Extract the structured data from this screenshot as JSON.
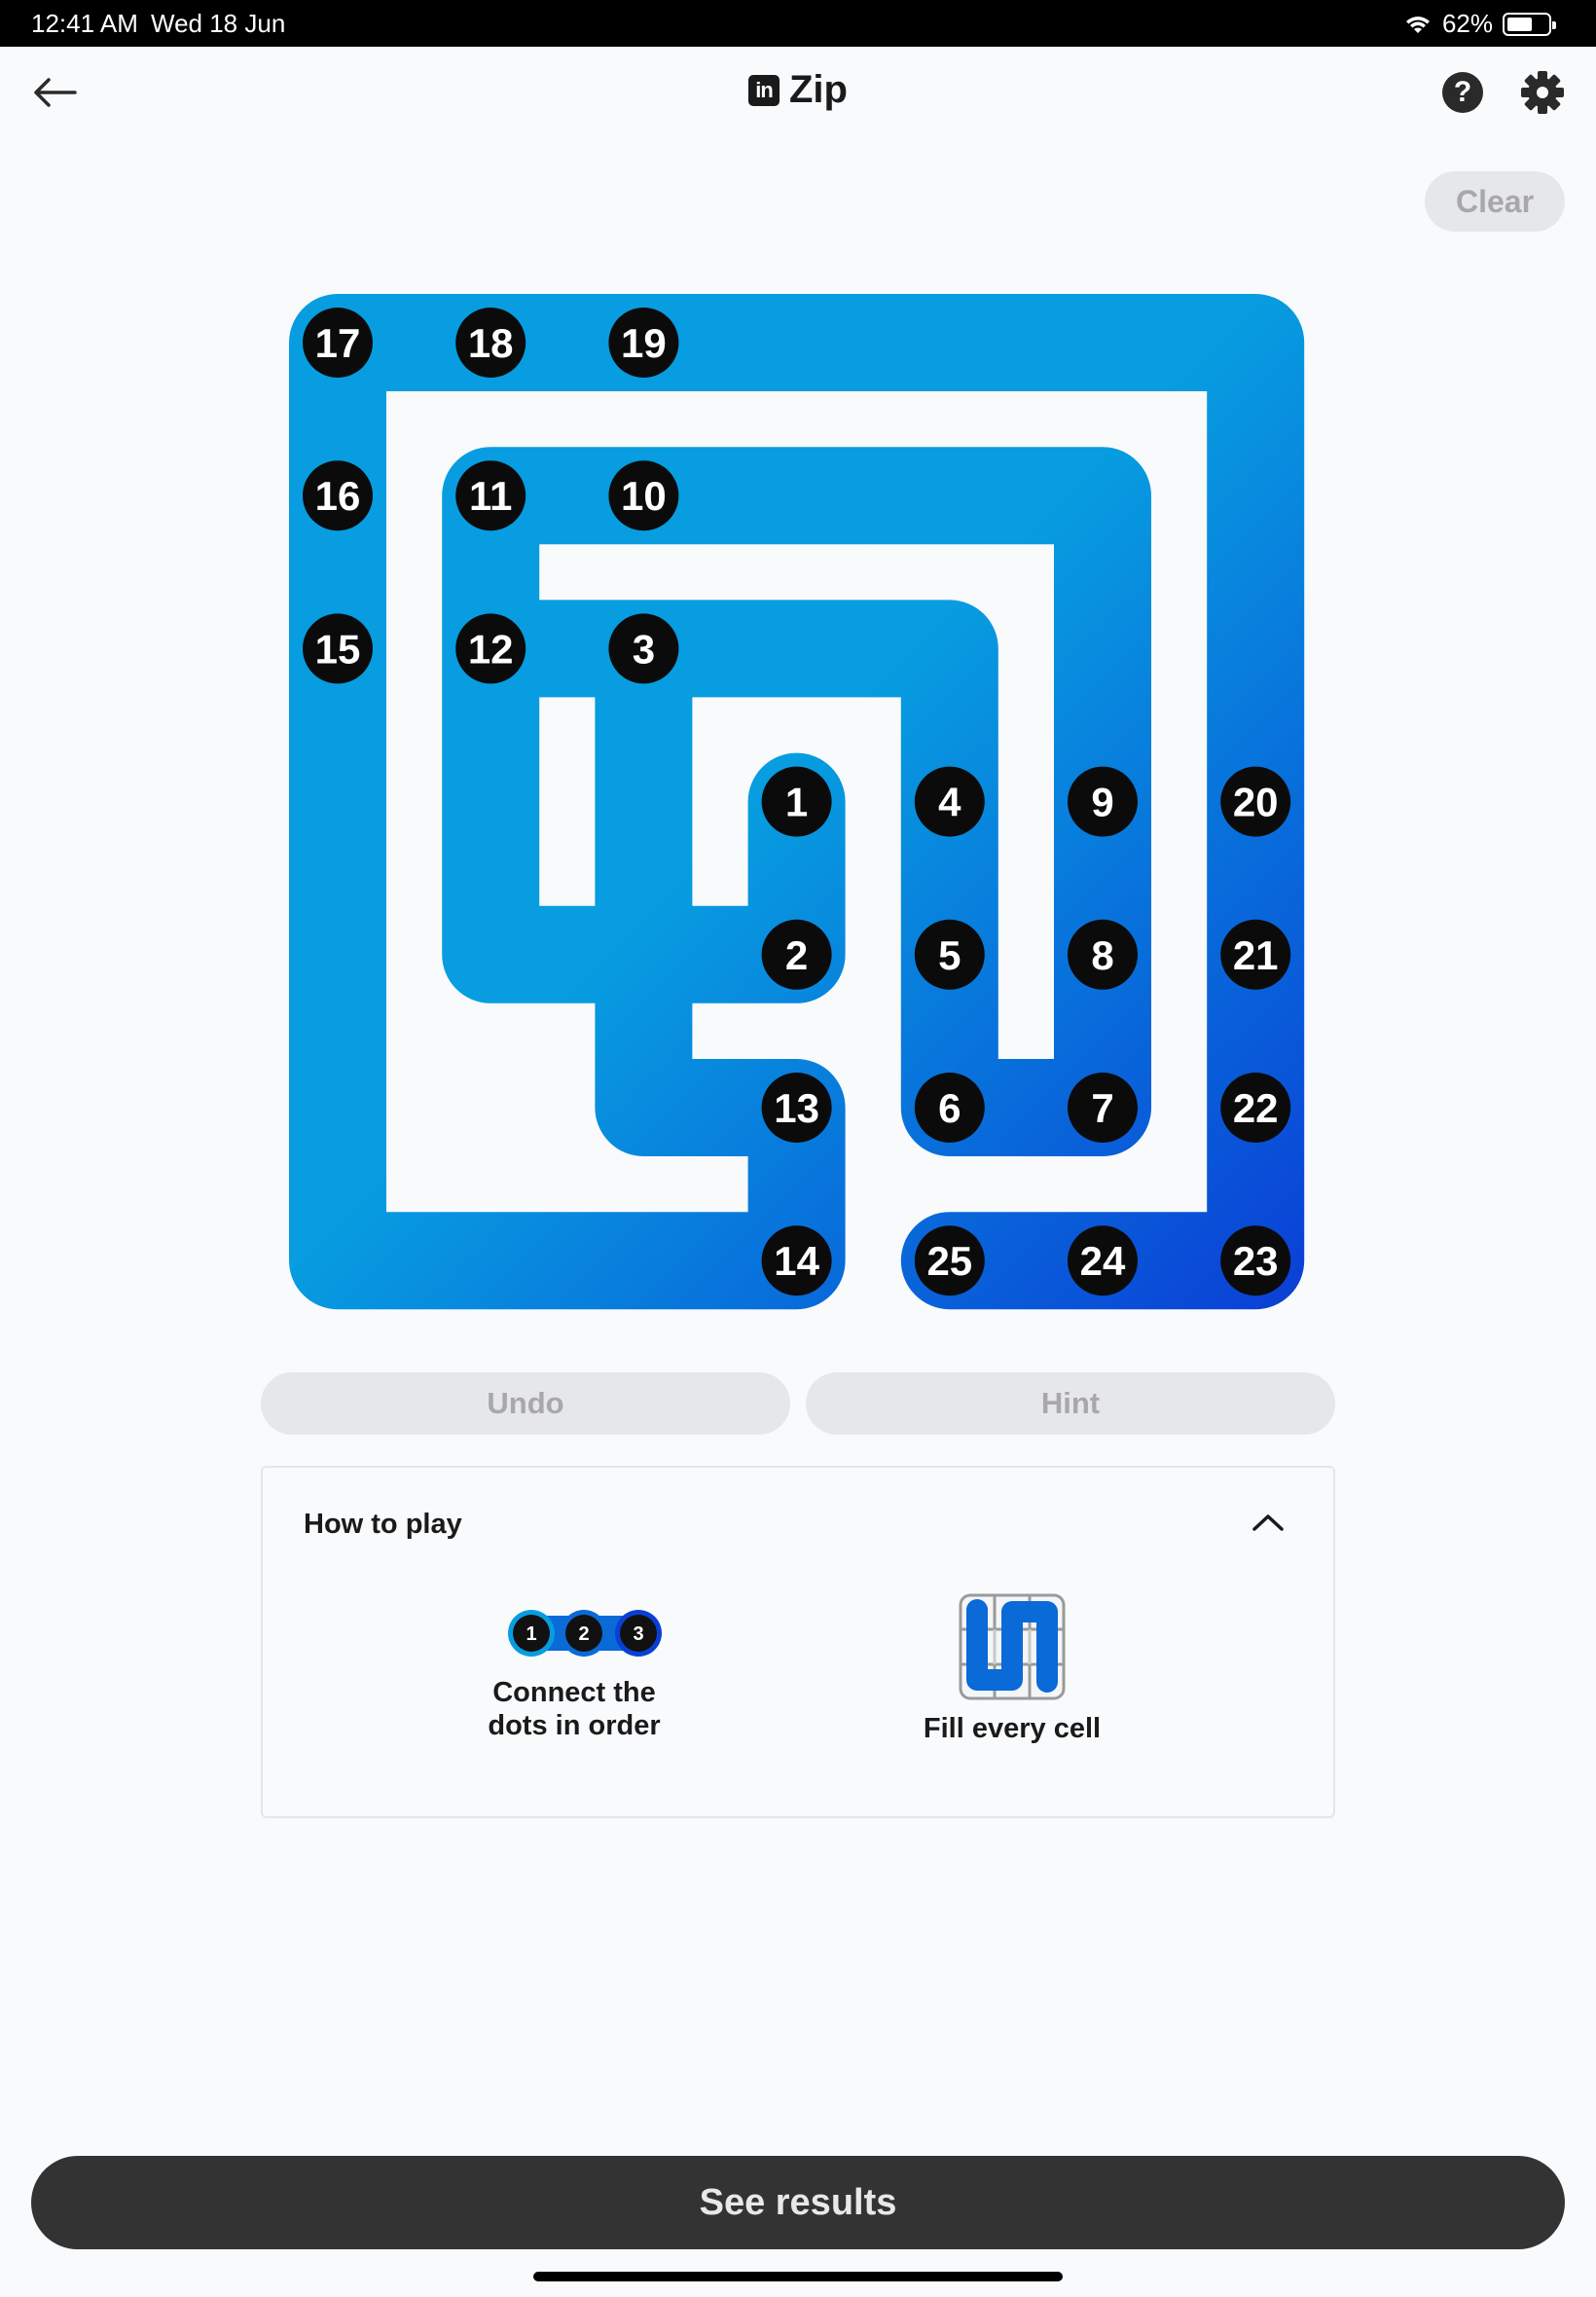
{
  "status_bar": {
    "time": "12:41 AM",
    "date": "Wed 18 Jun",
    "battery": "62%",
    "battery_level": 0.62
  },
  "header": {
    "title": "Zip",
    "logo_text": "in"
  },
  "toolbar": {
    "clear_label": "Clear"
  },
  "puzzle": {
    "grid_size": 6,
    "numbers": [
      {
        "n": 17,
        "row": 0,
        "col": 0
      },
      {
        "n": 18,
        "row": 0,
        "col": 1
      },
      {
        "n": 19,
        "row": 0,
        "col": 2
      },
      {
        "n": 16,
        "row": 1,
        "col": 0
      },
      {
        "n": 11,
        "row": 1,
        "col": 1
      },
      {
        "n": 10,
        "row": 1,
        "col": 2
      },
      {
        "n": 15,
        "row": 2,
        "col": 0
      },
      {
        "n": 12,
        "row": 2,
        "col": 1
      },
      {
        "n": 3,
        "row": 2,
        "col": 2
      },
      {
        "n": 1,
        "row": 3,
        "col": 3
      },
      {
        "n": 4,
        "row": 3,
        "col": 4
      },
      {
        "n": 9,
        "row": 3,
        "col": 5
      },
      {
        "n": 20,
        "row": 3,
        "col": 6
      },
      {
        "n": 2,
        "row": 4,
        "col": 3
      },
      {
        "n": 5,
        "row": 4,
        "col": 4
      },
      {
        "n": 8,
        "row": 4,
        "col": 5
      },
      {
        "n": 21,
        "row": 4,
        "col": 6
      },
      {
        "n": 13,
        "row": 5,
        "col": 3
      },
      {
        "n": 6,
        "row": 5,
        "col": 4
      },
      {
        "n": 7,
        "row": 5,
        "col": 5
      },
      {
        "n": 22,
        "row": 5,
        "col": 6
      },
      {
        "n": 14,
        "row": 6,
        "col": 3
      },
      {
        "n": 25,
        "row": 6,
        "col": 4
      },
      {
        "n": 24,
        "row": 6,
        "col": 5
      },
      {
        "n": 23,
        "row": 6,
        "col": 6
      }
    ],
    "path": [
      [
        3,
        3
      ],
      [
        4,
        3
      ],
      [
        4,
        2
      ],
      [
        4,
        1
      ],
      [
        3,
        1
      ],
      [
        2,
        1
      ],
      [
        2,
        2
      ],
      [
        2,
        3
      ],
      [
        2,
        4
      ],
      [
        3,
        4
      ],
      [
        4,
        4
      ],
      [
        5,
        4
      ],
      [
        5,
        5
      ],
      [
        4,
        5
      ],
      [
        3,
        5
      ],
      [
        2,
        5
      ],
      [
        1,
        5
      ],
      [
        1,
        4
      ],
      [
        1,
        3
      ],
      [
        1,
        2
      ],
      [
        1,
        1
      ],
      [
        2,
        1
      ],
      [
        2,
        2
      ],
      [
        3,
        2
      ],
      [
        4,
        2
      ],
      [
        5,
        2
      ],
      [
        5,
        3
      ],
      [
        6,
        3
      ],
      [
        6,
        2
      ],
      [
        6,
        1
      ],
      [
        6,
        0
      ],
      [
        5,
        0
      ],
      [
        4,
        0
      ],
      [
        3,
        0
      ],
      [
        2,
        0
      ],
      [
        1,
        0
      ],
      [
        0,
        0
      ],
      [
        0,
        1
      ],
      [
        0,
        2
      ],
      [
        0,
        3
      ],
      [
        0,
        4
      ],
      [
        0,
        5
      ],
      [
        0,
        6
      ],
      [
        1,
        6
      ],
      [
        2,
        6
      ],
      [
        3,
        6
      ],
      [
        4,
        6
      ],
      [
        5,
        6
      ],
      [
        6,
        6
      ],
      [
        6,
        5
      ],
      [
        6,
        4
      ]
    ],
    "colors": {
      "start": "#079de0",
      "end": "#0a3fd6"
    }
  },
  "actions": {
    "undo_label": "Undo",
    "hint_label": "Hint"
  },
  "how_to_play": {
    "title": "How to play",
    "rule1": "Connect the\ndots in order",
    "rule1_dots": [
      "1",
      "2",
      "3"
    ],
    "rule2": "Fill every cell"
  },
  "footer": {
    "results_label": "See results"
  }
}
